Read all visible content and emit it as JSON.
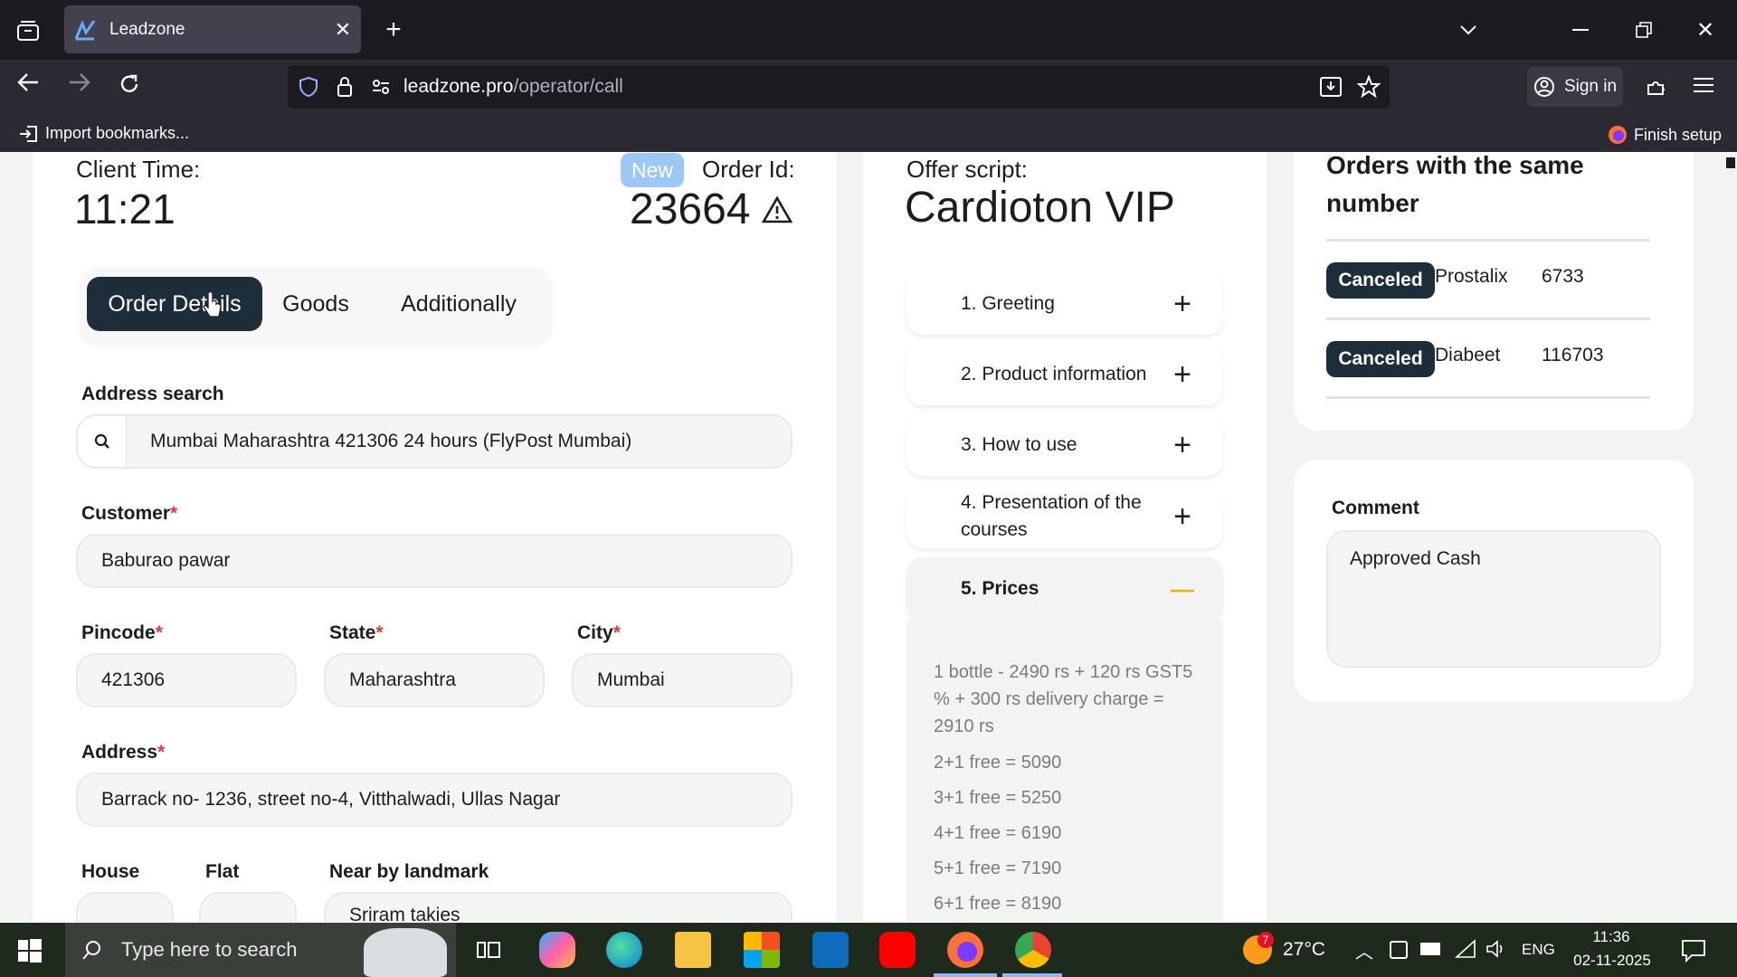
{
  "browser": {
    "tab_title": "Leadzone",
    "url_host": "leadzone.pro",
    "url_path": "/operator/call",
    "sign_in": "Sign in",
    "bookmarks": {
      "import": "Import bookmarks...",
      "finish_setup": "Finish setup"
    }
  },
  "header": {
    "client_time_label": "Client Time:",
    "client_time": "11:21",
    "new_badge": "New",
    "order_id_label": "Order Id:",
    "order_id": "23664"
  },
  "tabs": [
    "Order Details",
    "Goods",
    "Additionally"
  ],
  "form": {
    "address_search_label": "Address search",
    "address_search_value": "Mumbai Maharashtra 421306 24 hours (FlyPost Mumbai)",
    "customer_label": "Customer",
    "customer_value": "Baburao pawar",
    "pincode_label": "Pincode",
    "pincode_value": "421306",
    "state_label": "State",
    "state_value": "Maharashtra",
    "city_label": "City",
    "city_value": "Mumbai",
    "address_label": "Address",
    "address_value": "Barrack no- 1236, street no-4, Vitthalwadi, Ullas Nagar",
    "house_label": "House",
    "flat_label": "Flat",
    "landmark_label": "Near by landmark",
    "landmark_value": "Sriram takies",
    "required_mark": "*"
  },
  "script": {
    "label": "Offer script:",
    "title": "Cardioton VIP",
    "sections": [
      {
        "label": "1. Greeting",
        "sign": "+"
      },
      {
        "label": "2. Product information",
        "sign": "+"
      },
      {
        "label": "3. How to use",
        "sign": "+"
      },
      {
        "label": "4. Presentation of the courses",
        "sign": "+"
      },
      {
        "label": "5. Prices",
        "sign": "—"
      }
    ],
    "prices": [
      "1 bottle - 2490 rs + 120 rs GST5 % + 300 rs delivery charge = 2910 rs",
      "2+1 free = 5090",
      "3+1 free = 5250",
      "4+1 free = 6190",
      "5+1 free = 7190",
      "6+1 free = 8190"
    ]
  },
  "orders": {
    "title": "Orders with the same number",
    "rows": [
      {
        "status": "Canceled",
        "product": "Prostalix",
        "id": "6733"
      },
      {
        "status": "Canceled",
        "product": "Diabeet",
        "id": "116703"
      }
    ]
  },
  "comment": {
    "label": "Comment",
    "value": "Approved Cash"
  },
  "taskbar": {
    "search_placeholder": "Type here to search",
    "weather_badge": "7",
    "temperature": "27°C",
    "language": "ENG",
    "time": "11:36",
    "date": "02-11-2025"
  }
}
